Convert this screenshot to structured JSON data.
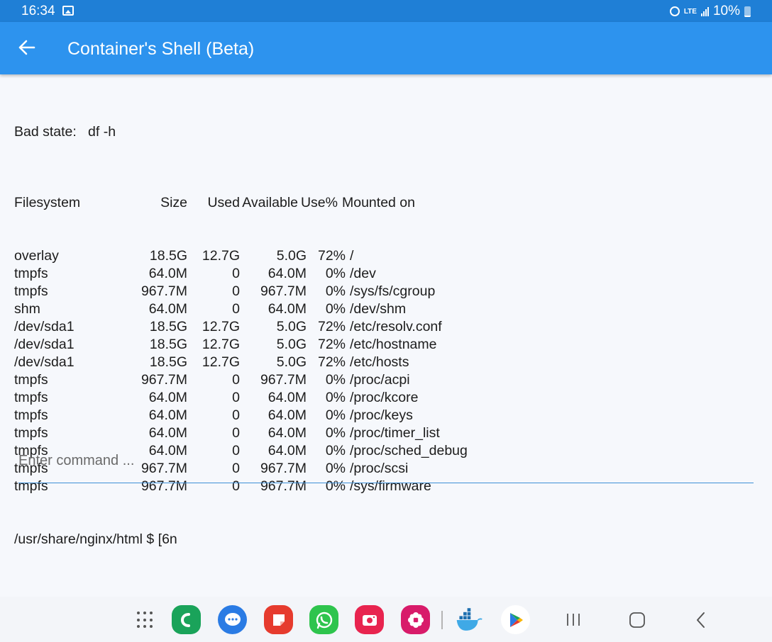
{
  "status_bar": {
    "time": "16:34",
    "battery": "10%",
    "network": "LTE",
    "icons": [
      "gallery-icon",
      "alarm-icon",
      "lte-icon",
      "signal-icon",
      "battery-icon"
    ]
  },
  "app_bar": {
    "back_icon": "arrow-left-icon",
    "title": "Container's Shell (Beta)",
    "color": "#2d93ee"
  },
  "terminal": {
    "command_line": "Bad state:   df -h",
    "header": {
      "fs": "Filesystem",
      "size": "Size",
      "used": "Used",
      "avail": "Available",
      "use": "Use%",
      "mnt": "Mounted on"
    },
    "rows": [
      {
        "fs": "overlay",
        "size": "18.5G",
        "used": "12.7G",
        "avail": "5.0G",
        "use": "72%",
        "mnt": "/"
      },
      {
        "fs": "tmpfs",
        "size": "64.0M",
        "used": "0",
        "avail": "64.0M",
        "use": "0%",
        "mnt": "/dev"
      },
      {
        "fs": "tmpfs",
        "size": "967.7M",
        "used": "0",
        "avail": "967.7M",
        "use": "0%",
        "mnt": "/sys/fs/cgroup"
      },
      {
        "fs": "shm",
        "size": "64.0M",
        "used": "0",
        "avail": "64.0M",
        "use": "0%",
        "mnt": "/dev/shm"
      },
      {
        "fs": "/dev/sda1",
        "size": "18.5G",
        "used": "12.7G",
        "avail": "5.0G",
        "use": "72%",
        "mnt": "/etc/resolv.conf"
      },
      {
        "fs": "/dev/sda1",
        "size": "18.5G",
        "used": "12.7G",
        "avail": "5.0G",
        "use": "72%",
        "mnt": "/etc/hostname"
      },
      {
        "fs": "/dev/sda1",
        "size": "18.5G",
        "used": "12.7G",
        "avail": "5.0G",
        "use": "72%",
        "mnt": "/etc/hosts"
      },
      {
        "fs": "tmpfs",
        "size": "967.7M",
        "used": "0",
        "avail": "967.7M",
        "use": "0%",
        "mnt": "/proc/acpi"
      },
      {
        "fs": "tmpfs",
        "size": "64.0M",
        "used": "0",
        "avail": "64.0M",
        "use": "0%",
        "mnt": "/proc/kcore"
      },
      {
        "fs": "tmpfs",
        "size": "64.0M",
        "used": "0",
        "avail": "64.0M",
        "use": "0%",
        "mnt": "/proc/keys"
      },
      {
        "fs": "tmpfs",
        "size": "64.0M",
        "used": "0",
        "avail": "64.0M",
        "use": "0%",
        "mnt": "/proc/timer_list"
      },
      {
        "fs": "tmpfs",
        "size": "64.0M",
        "used": "0",
        "avail": "64.0M",
        "use": "0%",
        "mnt": "/proc/sched_debug"
      },
      {
        "fs": "tmpfs",
        "size": "967.7M",
        "used": "0",
        "avail": "967.7M",
        "use": "0%",
        "mnt": "/proc/scsi"
      },
      {
        "fs": "tmpfs",
        "size": "967.7M",
        "used": "0",
        "avail": "967.7M",
        "use": "0%",
        "mnt": "/sys/firmware"
      }
    ],
    "prompt": "/usr/share/nginx/html $ [6n"
  },
  "command_input": {
    "placeholder": "Enter command ...",
    "value": ""
  },
  "nav_bar": {
    "apps": [
      {
        "name": "phone-app-icon",
        "color": "#1aa35a"
      },
      {
        "name": "messages-app-icon",
        "color": "#2a7be4"
      },
      {
        "name": "notes-app-icon",
        "color": "#e63b2e"
      },
      {
        "name": "whatsapp-app-icon",
        "color": "#2ec44d"
      },
      {
        "name": "camera-app-icon",
        "color": "#e8244f"
      },
      {
        "name": "flower-app-icon",
        "color": "#d81b6a"
      },
      {
        "name": "docker-app-icon",
        "color": "#1d8fd8"
      },
      {
        "name": "play-store-app-icon",
        "color": "#ffffff"
      }
    ],
    "buttons": [
      "recent-apps-icon",
      "home-icon",
      "back-nav-icon"
    ]
  }
}
